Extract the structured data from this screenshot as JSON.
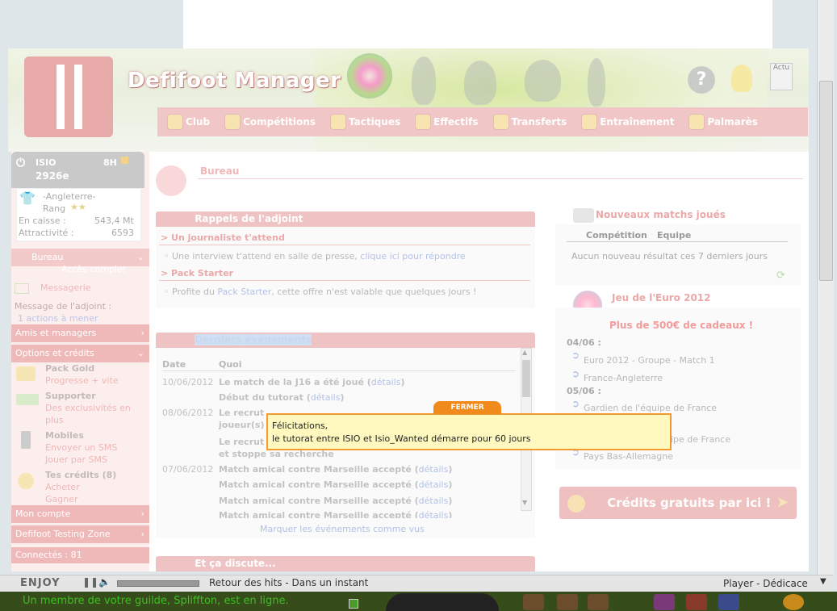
{
  "header": {
    "site_title": "Defifoot Manager",
    "actu_label": "Actu"
  },
  "nav": {
    "items": [
      {
        "label": "Club"
      },
      {
        "label": "Compétitions"
      },
      {
        "label": "Tactiques"
      },
      {
        "label": "Effectifs"
      },
      {
        "label": "Transferts"
      },
      {
        "label": "Entraînement"
      },
      {
        "label": "Palmarès"
      }
    ]
  },
  "sidebar": {
    "user_name": "ISIO",
    "user_money_short": "2926e",
    "time_badge": "8H",
    "club_name": "-Angleterre-",
    "rank_label": "Rang",
    "cash_label": "En caisse :",
    "cash_value": "543,4 Mt",
    "attract_label": "Attractivité :",
    "attract_value": "6593",
    "bureau_label": "Bureau",
    "acces_label": "Accès complet",
    "messagerie": "Messagerie",
    "adjoint_msg": "Message de l'adjoint :",
    "adjoint_actions": "1 actions à mener",
    "amis": "Amis et managers",
    "options": "Options et crédits",
    "pack_gold_title": "Pack Gold",
    "pack_gold_sub": "Progresse + vite",
    "supporter_title": "Supporter",
    "supporter_sub1": "Des exclusivités en",
    "supporter_sub2": "plus",
    "mobiles_title": "Mobiles",
    "mobiles_sub1": "Envoyer un SMS",
    "mobiles_sub2": "Jouer par SMS",
    "credits_title": "Tes crédits (8)",
    "credits_sub1": "Acheter",
    "credits_sub2": "Gagner",
    "mon_compte": "Mon compte",
    "testing_zone": "Defifoot Testing Zone",
    "connectes": "Connectés : 81"
  },
  "main": {
    "bureau_title": "Bureau",
    "rappels": {
      "title": "Rappels de l'adjoint",
      "item1_title": "> Un journaliste t'attend",
      "item1_text": "Une interview t'attend en salle de presse,",
      "item1_link": "clique ici pour répondre",
      "item2_title": "> Pack Starter",
      "item2_text_pre": "Profite du",
      "item2_link": "Pack Starter",
      "item2_text_post": ", cette offre n'est valable que quelques jours !"
    },
    "events": {
      "title": "Derniers évènements",
      "col_date": "Date",
      "col_quoi": "Quoi",
      "details": "détails",
      "rows": [
        {
          "date": "10/06/2012",
          "text": "Le match de la J16 a été joué"
        },
        {
          "date": "",
          "text": "Début du tutorat"
        },
        {
          "date": "08/06/2012",
          "text": "Le recrut"
        },
        {
          "date": "",
          "text": "joueur(s)"
        },
        {
          "date": "",
          "text": "Le recrut"
        },
        {
          "date": "",
          "text": "et stoppe sa recherche"
        },
        {
          "date": "07/06/2012",
          "text": "Match amical contre Marseille accepté"
        },
        {
          "date": "",
          "text": "Match amical contre Marseille accepté"
        },
        {
          "date": "",
          "text": "Match amical contre Marseille accepté"
        },
        {
          "date": "",
          "text": "Match amical contre Marseille accepté"
        }
      ],
      "mark_seen": "Marquer les événements comme vus"
    },
    "discute_title": "Et ça discute...",
    "nouveaux": {
      "title": "Nouveaux matchs joués",
      "col_comp": "Compétition",
      "col_equipe": "Equipe",
      "empty": "Aucun nouveau résultat ces 7 derniers jours"
    },
    "euro": {
      "title": "Jeu de l'Euro 2012",
      "promo": "Plus de 500€ de cadeaux !",
      "date1": "04/06 :",
      "m1": "Euro 2012 - Groupe - Match 1",
      "m2": "France-Angleterre",
      "date2": "05/06 :",
      "m3": "Gardien de l'équipe de France",
      "m4": "ipe de France",
      "m5": "Pays Bas-Allemagne"
    },
    "credits_btn": "Crédits gratuits par ici !"
  },
  "tooltip": {
    "close": "FERMER",
    "line1": "Félicitations,",
    "line2": "le tutorat entre ISIO et Isio_Wanted démarre pour 60 jours"
  },
  "player": {
    "brand": "ENJOY",
    "now_playing": "Retour des hits - Dans un instant",
    "mode": "Player - Dédicace"
  },
  "bottom": {
    "guild_msg": "Un membre de votre guilde, Spliffton, est en ligne."
  }
}
